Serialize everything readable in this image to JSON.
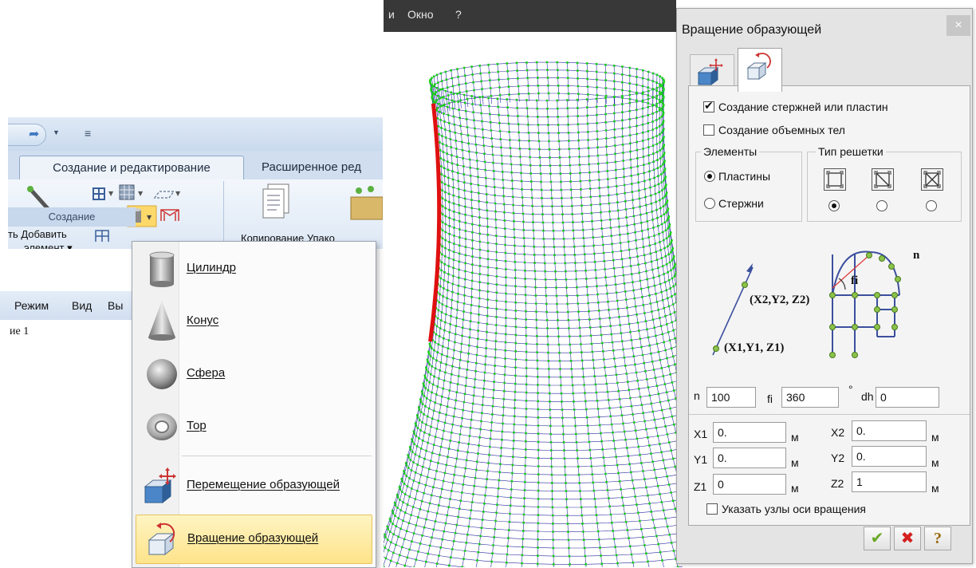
{
  "ribbon": {
    "tab_active": "Создание и редактирование",
    "tab_other": "Расширенное ред",
    "add_element_line1": "ть Добавить",
    "add_element_line2": "элемент",
    "group_label": "Создание",
    "copy_label": "Копирование  Упако",
    "menubar": [
      "Режим",
      "Вид",
      "Вы"
    ],
    "doc_label": "ие 1"
  },
  "dropdown": {
    "items": [
      {
        "label": "Цилиндр",
        "icon": "cylinder-icon"
      },
      {
        "label": "Конус",
        "icon": "cone-icon"
      },
      {
        "label": "Сфера",
        "icon": "sphere-icon"
      },
      {
        "label": "Тор",
        "icon": "torus-icon"
      },
      {
        "label": "Перемещение образующей",
        "icon": "move-generatrix-icon"
      },
      {
        "label": "Вращение образующей",
        "icon": "rotate-generatrix-icon",
        "highlighted": true
      }
    ]
  },
  "topmenu": {
    "window": "Окно",
    "help": "?"
  },
  "dialog": {
    "title": "Вращение образующей",
    "close_glyph": "×",
    "check_rods": "Создание стержней или пластин",
    "check_rods_checked": true,
    "check_volumes": "Создание объемных тел",
    "check_volumes_checked": false,
    "elements_group": "Элементы",
    "radio_plates": "Пластины",
    "radio_rods": "Стержни",
    "lattice_group": "Тип решетки",
    "diagram": {
      "n": "n",
      "fi": "fi",
      "p2": "(X2,Y2, Z2)",
      "p1": "(X1,Y1, Z1)"
    },
    "n_label": "n",
    "n_value": "100",
    "fi_label": "fi",
    "fi_value": "360",
    "deg": "°",
    "dh_label": "dh",
    "dh_value": "0",
    "x1_label": "X1",
    "x1_value": "0.",
    "y1_label": "Y1",
    "y1_value": "0.",
    "z1_label": "Z1",
    "z1_value": "0",
    "x2_label": "X2",
    "x2_value": "0.",
    "y2_label": "Y2",
    "y2_value": "0.",
    "z2_label": "Z2",
    "z2_value": "1",
    "unit": "м",
    "check_axis": "Указать узлы оси вращения",
    "check_axis_checked": false,
    "ok_glyph": "✔",
    "cancel_glyph": "✖",
    "help_glyph": "?"
  },
  "colors": {
    "mesh_line": "#2a2aa0",
    "mesh_node": "#18d018",
    "generatrix": "#e01010",
    "menu_highlight": "#fde38a"
  }
}
